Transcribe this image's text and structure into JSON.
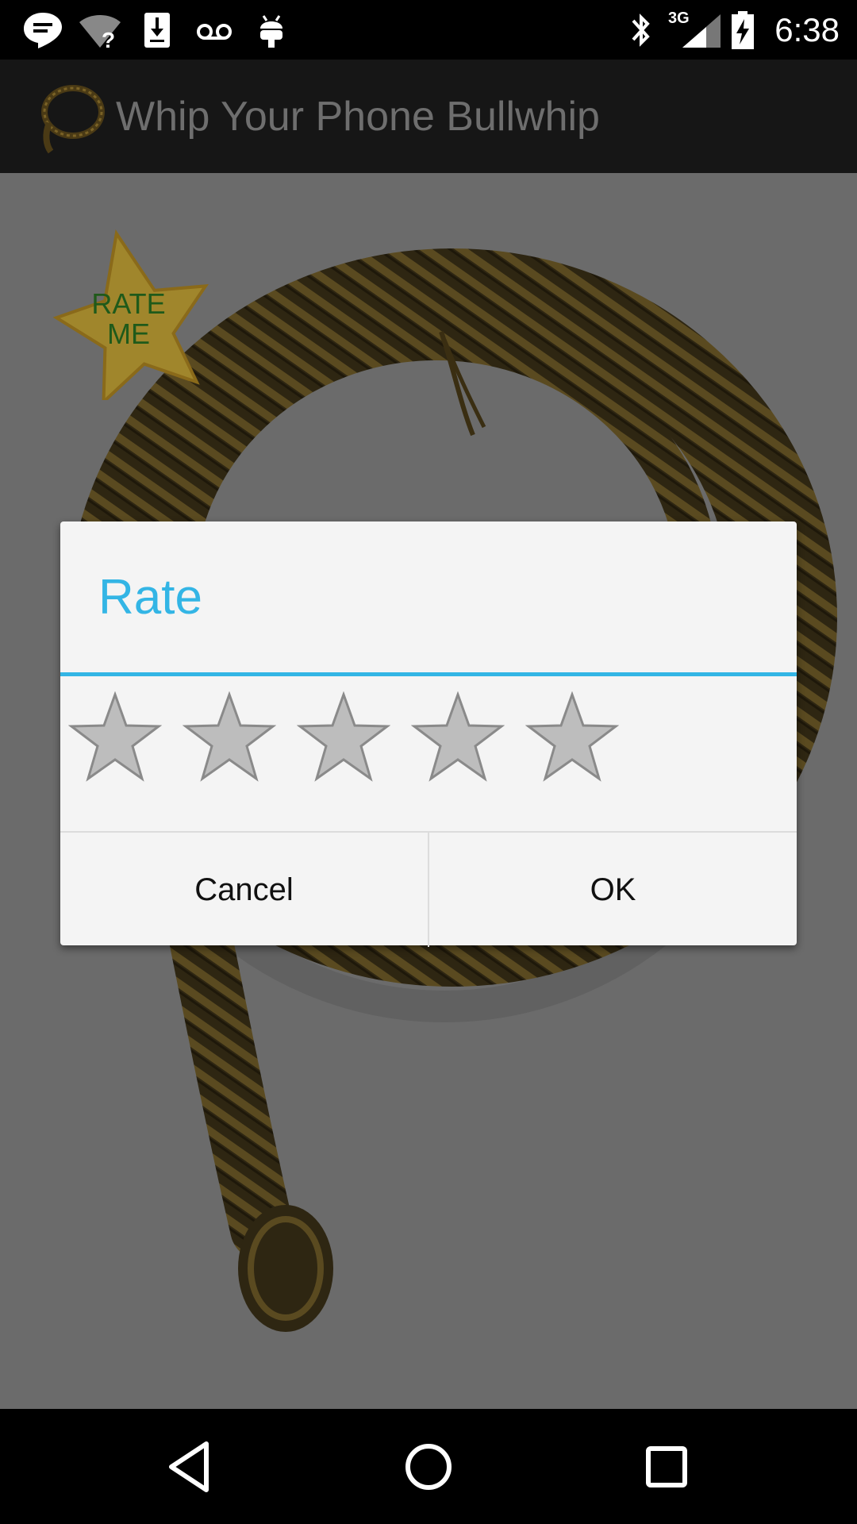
{
  "status_bar": {
    "time": "6:38",
    "network_type": "3G",
    "left_icons": [
      "hangouts-icon",
      "wifi-unknown-icon",
      "download-icon",
      "voicemail-icon",
      "android-icon"
    ],
    "right_icons": [
      "bluetooth-icon",
      "cell-signal-icon",
      "battery-charging-icon"
    ]
  },
  "app_bar": {
    "title": "Whip Your Phone Bullwhip",
    "logo_icon": "whip-logo-icon"
  },
  "content": {
    "rate_me_badge": "RATE\nME",
    "rate_me_line1": "RATE",
    "rate_me_line2": "ME"
  },
  "dialog": {
    "title": "Rate",
    "rating": {
      "value": 0,
      "max": 5
    },
    "cancel_label": "Cancel",
    "ok_label": "OK"
  },
  "colors": {
    "accent": "#33b5e5",
    "dialog_bg": "#f4f4f4",
    "star_fill": "#bdbdbd",
    "star_stroke": "#8a8a8a"
  },
  "nav_bar": {
    "items": [
      "back-icon",
      "home-icon",
      "recents-icon"
    ]
  }
}
